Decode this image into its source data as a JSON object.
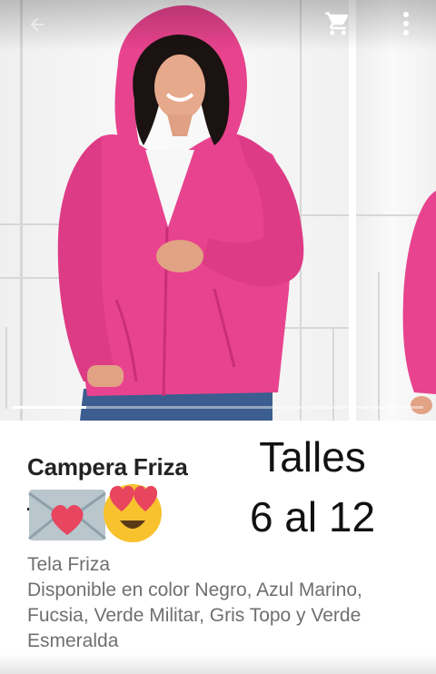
{
  "product": {
    "title": "Campera Friza",
    "sizes_heading": "Talles",
    "sizes_range": "6 al 12",
    "description": [
      "Tela Friza",
      "Disponible en color Negro, Azul Marino,",
      "Fucsia, Verde Militar, Gris Topo y Verde",
      "Esmeralda"
    ]
  },
  "toolbar": {
    "back_icon": "arrow-back-icon",
    "cart_icon": "shopping-cart-icon",
    "menu_icon": "more-vert-icon"
  },
  "emojis": [
    "love-letter-icon",
    "heart-eyes-smiley-icon"
  ],
  "gallery": {
    "progress": 0.18
  },
  "colors": {
    "jacket_pink": "#e8438e",
    "jacket_shadow": "#c92f77",
    "wall": "#f3f3f3",
    "text_dark": "#222222",
    "text_muted": "#6f6f6f"
  }
}
